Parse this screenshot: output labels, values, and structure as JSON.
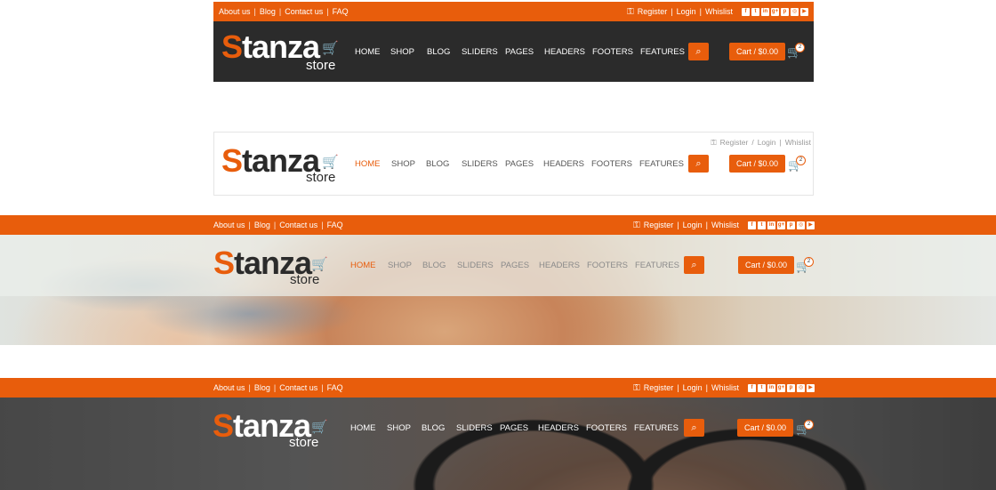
{
  "top_links": [
    "About us",
    "Blog",
    "Contact us",
    "FAQ"
  ],
  "account_links": [
    "Register",
    "Login",
    "Whislist"
  ],
  "social_icons": [
    "facebook-icon",
    "twitter-icon",
    "linkedin-icon",
    "google-plus-icon",
    "pinterest-icon",
    "instagram-icon",
    "youtube-icon"
  ],
  "social_glyphs": [
    "f",
    "t",
    "in",
    "g+",
    "p",
    "◎",
    "▶"
  ],
  "logo": {
    "word_first": "S",
    "word_rest": "tanza",
    "sub": "store"
  },
  "nav": [
    "HOME",
    "SHOP",
    "BLOG",
    "SLIDERS",
    "PAGES",
    "HEADERS",
    "FOOTERS",
    "FEATURES"
  ],
  "cart": {
    "label": "Cart / $0.00",
    "count": "2"
  },
  "colors": {
    "accent": "#e85d0c",
    "dark": "#2b2b2b"
  }
}
